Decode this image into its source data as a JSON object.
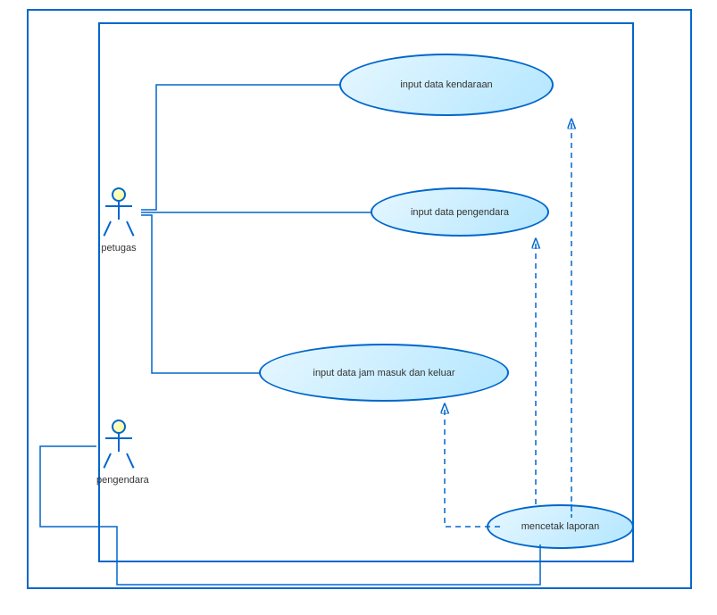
{
  "diagram": {
    "type": "use_case_diagram",
    "actors": [
      {
        "id": "actor1",
        "label": "petugas"
      },
      {
        "id": "actor2",
        "label": "pengendara"
      }
    ],
    "usecases": [
      {
        "id": "uc1",
        "label": "input data kendaraan"
      },
      {
        "id": "uc2",
        "label": "input data pengendara"
      },
      {
        "id": "uc3",
        "label": "input data jam masuk dan keluar"
      },
      {
        "id": "uc4",
        "label": "mencetak laporan"
      }
    ],
    "associations": [
      {
        "from": "actor1",
        "to": "uc1",
        "type": "solid"
      },
      {
        "from": "actor1",
        "to": "uc2",
        "type": "solid"
      },
      {
        "from": "actor1",
        "to": "uc3",
        "type": "solid"
      },
      {
        "from": "actor2",
        "to": "uc4",
        "type": "solid"
      },
      {
        "from": "uc4",
        "to": "uc1",
        "type": "dashed"
      },
      {
        "from": "uc4",
        "to": "uc2",
        "type": "dashed"
      },
      {
        "from": "uc4",
        "to": "uc3",
        "type": "dashed"
      }
    ]
  }
}
